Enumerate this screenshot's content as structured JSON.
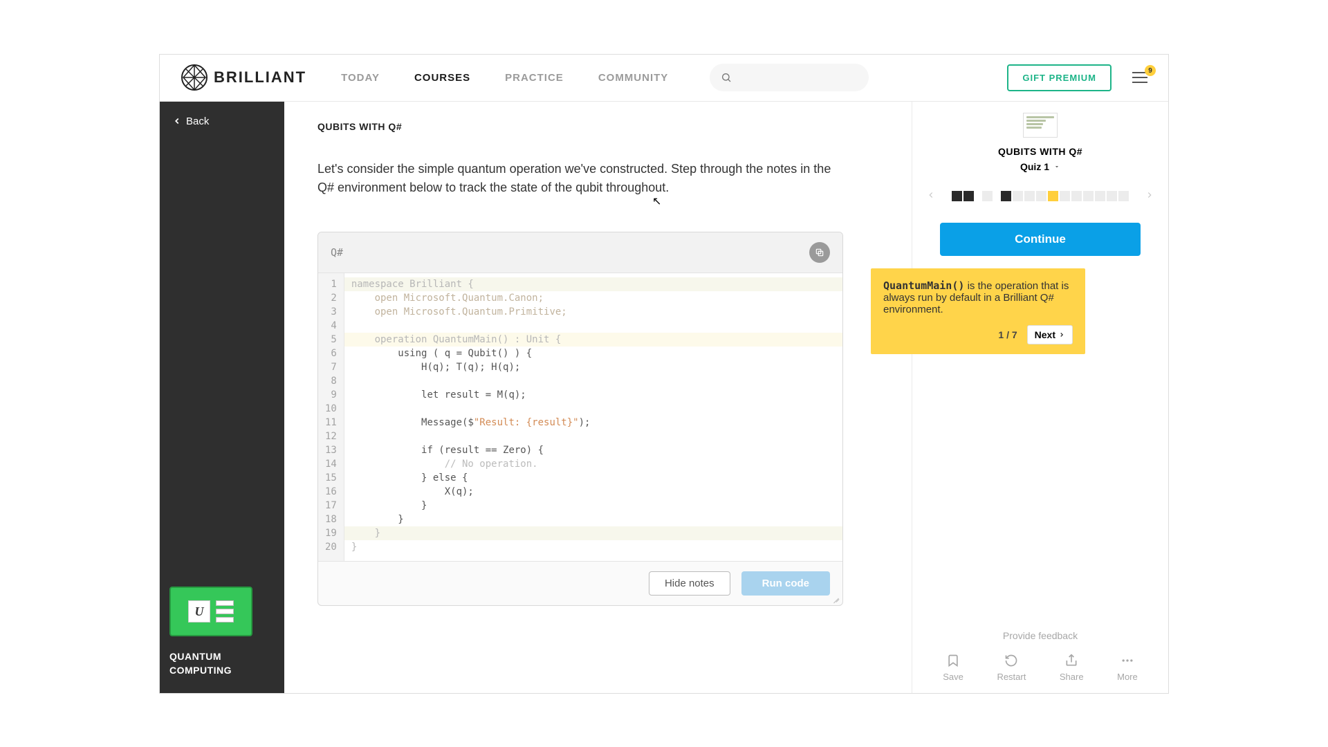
{
  "header": {
    "brand": "BRILLIANT",
    "nav": [
      "TODAY",
      "COURSES",
      "PRACTICE",
      "COMMUNITY"
    ],
    "active_nav_index": 1,
    "gift_label": "GIFT PREMIUM",
    "notif_count": "9"
  },
  "sidebar": {
    "back_label": "Back",
    "course_name": "QUANTUM COMPUTING"
  },
  "content": {
    "page_title": "QUBITS WITH Q#",
    "intro": "Let's consider the simple quantum operation we've constructed. Step through the notes in the Q# environment below to track the state of the qubit throughout.",
    "code": {
      "language_label": "Q#",
      "hide_notes_label": "Hide notes",
      "run_label": "Run code",
      "lines": [
        {
          "n": 1,
          "cls": "hl-ns",
          "html": "<span class='tok-dim'>namespace Brilliant {</span>"
        },
        {
          "n": 2,
          "cls": "",
          "html": "    <span class='tok-open'>open Microsoft.Quantum.Canon;</span>"
        },
        {
          "n": 3,
          "cls": "",
          "html": "    <span class='tok-open'>open Microsoft.Quantum.Primitive;</span>"
        },
        {
          "n": 4,
          "cls": "",
          "html": ""
        },
        {
          "n": 5,
          "cls": "hl-op",
          "html": "    <span class='tok-dim'>operation QuantumMain() : Unit {</span>"
        },
        {
          "n": 6,
          "cls": "",
          "html": "        <span class='tok-norm'>using ( q = Qubit() ) {</span>"
        },
        {
          "n": 7,
          "cls": "",
          "html": "            <span class='tok-norm'>H(q); T(q); H(q);</span>"
        },
        {
          "n": 8,
          "cls": "",
          "html": ""
        },
        {
          "n": 9,
          "cls": "",
          "html": "            <span class='tok-norm'>let result = M(q);</span>"
        },
        {
          "n": 10,
          "cls": "",
          "html": ""
        },
        {
          "n": 11,
          "cls": "",
          "html": "            <span class='tok-norm'>Message($</span><span class='tok-str'>\"Result: {result}\"</span><span class='tok-norm'>);</span>"
        },
        {
          "n": 12,
          "cls": "",
          "html": ""
        },
        {
          "n": 13,
          "cls": "",
          "html": "            <span class='tok-norm'>if (result == Zero) {</span>"
        },
        {
          "n": 14,
          "cls": "",
          "html": "                <span class='tok-comm'>// No operation.</span>"
        },
        {
          "n": 15,
          "cls": "",
          "html": "            <span class='tok-norm'>} else {</span>"
        },
        {
          "n": 16,
          "cls": "",
          "html": "                <span class='tok-norm'>X(q);</span>"
        },
        {
          "n": 17,
          "cls": "",
          "html": "            <span class='tok-norm'>}</span>"
        },
        {
          "n": 18,
          "cls": "",
          "html": "        <span class='tok-norm'>}</span>"
        },
        {
          "n": 19,
          "cls": "hl-ns",
          "html": "    <span class='tok-dim'>}</span>"
        },
        {
          "n": 20,
          "cls": "",
          "html": "<span class='tok-dim'>}</span>"
        }
      ]
    }
  },
  "rpanel": {
    "title": "QUBITS WITH Q#",
    "quiz_label": "Quiz 1",
    "progress": [
      "done",
      "done",
      "empty",
      "done",
      "empty",
      "empty",
      "empty",
      "current",
      "empty",
      "empty",
      "empty",
      "empty",
      "empty",
      "empty"
    ],
    "progress_groups": [
      2,
      1,
      11
    ],
    "continue_label": "Continue",
    "tooltip": {
      "code_token": "QuantumMain()",
      "text_rest": " is the operation that is always run by default in a Brilliant Q# environment.",
      "step": "1 / 7",
      "next_label": "Next"
    },
    "feedback_label": "Provide feedback",
    "actions": [
      "Save",
      "Restart",
      "Share",
      "More"
    ]
  }
}
